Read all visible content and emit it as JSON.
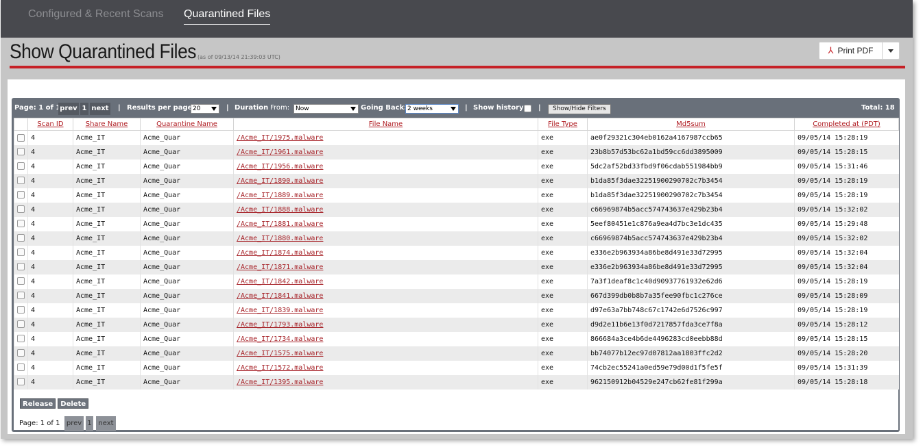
{
  "nav": {
    "tabs": [
      {
        "label": "Configured & Recent Scans"
      },
      {
        "label": "Quarantined Files"
      }
    ]
  },
  "header": {
    "title": "Show Quarantined Files",
    "as_of": "(as of 09/13/14 21:39:03 UTC)",
    "print_label": "Print PDF"
  },
  "filters": {
    "page_text": "Page: 1 of 1",
    "prev": "prev",
    "page_num": "1",
    "next": "next",
    "sep": "|",
    "results_label": "Results per page:",
    "results_value": "20",
    "duration_label": "Duration",
    "from_label": "From:",
    "from_value": "Now",
    "going_back_label": "Going Back:",
    "going_back_value": "2 weeks",
    "show_history_label": "Show history:",
    "toggle_filters": "Show/Hide Filters",
    "total": "Total: 18"
  },
  "columns": [
    "Scan ID",
    "Share Name",
    "Quarantine Name",
    "File Name",
    "File Type",
    "Md5sum",
    "Completed at (PDT)"
  ],
  "rows": [
    {
      "scan_id": "4",
      "share": "Acme_IT",
      "quar": "Acme_Quar",
      "file": "/Acme_IT/1975.malware",
      "type": "exe",
      "md5": "ae0f29321c304eb0162a4167987ccb65",
      "completed": "09/05/14 15:28:19"
    },
    {
      "scan_id": "4",
      "share": "Acme_IT",
      "quar": "Acme_Quar",
      "file": "/Acme_IT/1961.malware",
      "type": "exe",
      "md5": "23b8b57d53bc62a1bd59cc6dd3895009",
      "completed": "09/05/14 15:28:15"
    },
    {
      "scan_id": "4",
      "share": "Acme_IT",
      "quar": "Acme_Quar",
      "file": "/Acme_IT/1956.malware",
      "type": "exe",
      "md5": "5dc2af52bd33fbd9f06cdab551984bb9",
      "completed": "09/05/14 15:31:46"
    },
    {
      "scan_id": "4",
      "share": "Acme_IT",
      "quar": "Acme_Quar",
      "file": "/Acme_IT/1890.malware",
      "type": "exe",
      "md5": "b1da85f3dae32251900290702c7b3454",
      "completed": "09/05/14 15:28:19"
    },
    {
      "scan_id": "4",
      "share": "Acme_IT",
      "quar": "Acme_Quar",
      "file": "/Acme_IT/1889.malware",
      "type": "exe",
      "md5": "b1da85f3dae32251900290702c7b3454",
      "completed": "09/05/14 15:28:19"
    },
    {
      "scan_id": "4",
      "share": "Acme_IT",
      "quar": "Acme_Quar",
      "file": "/Acme_IT/1888.malware",
      "type": "exe",
      "md5": "c66969874b5acc574743637e429b23b4",
      "completed": "09/05/14 15:32:02"
    },
    {
      "scan_id": "4",
      "share": "Acme_IT",
      "quar": "Acme_Quar",
      "file": "/Acme_IT/1881.malware",
      "type": "exe",
      "md5": "5eef80451e1c876a9ea4d7bc3e1dc435",
      "completed": "09/05/14 15:29:48"
    },
    {
      "scan_id": "4",
      "share": "Acme_IT",
      "quar": "Acme_Quar",
      "file": "/Acme_IT/1880.malware",
      "type": "exe",
      "md5": "c66969874b5acc574743637e429b23b4",
      "completed": "09/05/14 15:32:02"
    },
    {
      "scan_id": "4",
      "share": "Acme_IT",
      "quar": "Acme_Quar",
      "file": "/Acme_IT/1874.malware",
      "type": "exe",
      "md5": "e336e2b963934a86be8d491e33d72995",
      "completed": "09/05/14 15:32:04"
    },
    {
      "scan_id": "4",
      "share": "Acme_IT",
      "quar": "Acme_Quar",
      "file": "/Acme_IT/1871.malware",
      "type": "exe",
      "md5": "e336e2b963934a86be8d491e33d72995",
      "completed": "09/05/14 15:32:04"
    },
    {
      "scan_id": "4",
      "share": "Acme_IT",
      "quar": "Acme_Quar",
      "file": "/Acme_IT/1842.malware",
      "type": "exe",
      "md5": "7a3f1deaf8c1c40d90937761932e62d6",
      "completed": "09/05/14 15:28:19"
    },
    {
      "scan_id": "4",
      "share": "Acme_IT",
      "quar": "Acme_Quar",
      "file": "/Acme_IT/1841.malware",
      "type": "exe",
      "md5": "667d399db0b8b7a35fee90fbc1c276ce",
      "completed": "09/05/14 15:28:09"
    },
    {
      "scan_id": "4",
      "share": "Acme_IT",
      "quar": "Acme_Quar",
      "file": "/Acme_IT/1839.malware",
      "type": "exe",
      "md5": "d97e63a7bb748c67c1742e6d7526c997",
      "completed": "09/05/14 15:28:19"
    },
    {
      "scan_id": "4",
      "share": "Acme_IT",
      "quar": "Acme_Quar",
      "file": "/Acme_IT/1793.malware",
      "type": "exe",
      "md5": "d9d2e11b6e13f0d7217857fda3ce7f8a",
      "completed": "09/05/14 15:28:12"
    },
    {
      "scan_id": "4",
      "share": "Acme_IT",
      "quar": "Acme_Quar",
      "file": "/Acme_IT/1734.malware",
      "type": "exe",
      "md5": "866684a3ce4b6de4496283cd0eebb88d",
      "completed": "09/05/14 15:28:15"
    },
    {
      "scan_id": "4",
      "share": "Acme_IT",
      "quar": "Acme_Quar",
      "file": "/Acme_IT/1575.malware",
      "type": "exe",
      "md5": "bb74077b12ec97d07812aa1803ffc2d2",
      "completed": "09/05/14 15:28:20"
    },
    {
      "scan_id": "4",
      "share": "Acme_IT",
      "quar": "Acme_Quar",
      "file": "/Acme_IT/1572.malware",
      "type": "exe",
      "md5": "74cb2ec55241a0ed59e79d00d1f5fe5f",
      "completed": "09/05/14 15:31:39"
    },
    {
      "scan_id": "4",
      "share": "Acme_IT",
      "quar": "Acme_Quar",
      "file": "/Acme_IT/1395.malware",
      "type": "exe",
      "md5": "962150912b04529e247cb62fe81f299a",
      "completed": "09/05/14 15:28:18"
    }
  ],
  "actions": {
    "release": "Release",
    "delete": "Delete"
  },
  "bottom_pager": {
    "page_text": "Page: 1 of 1",
    "prev": "prev",
    "page_num": "1",
    "next": "next"
  },
  "colors": {
    "accent_red": "#c62026",
    "nav_bg": "#48494e",
    "panel_bg": "#69707a"
  },
  "icons": {
    "print": "pdf-icon",
    "dropdown": "chevron-down-icon"
  }
}
